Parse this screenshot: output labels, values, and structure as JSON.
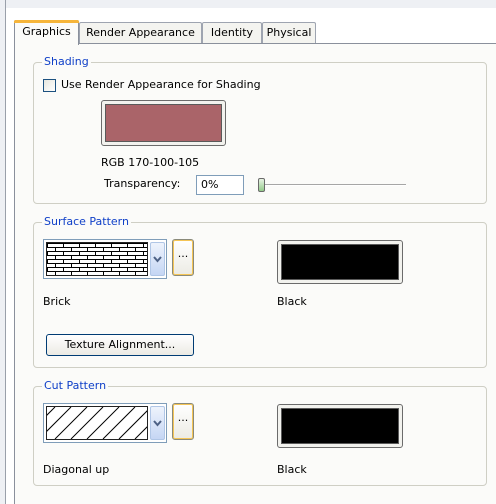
{
  "tabs": [
    {
      "label": "Graphics",
      "active": true
    },
    {
      "label": "Render Appearance",
      "active": false
    },
    {
      "label": "Identity",
      "active": false
    },
    {
      "label": "Physical",
      "active": false
    }
  ],
  "shading": {
    "legend": "Shading",
    "use_render_checkbox_label": "Use Render Appearance for Shading",
    "use_render_checked": false,
    "color_hex": "#aa6469",
    "rgb_label": "RGB 170-100-105",
    "transparency_label": "Transparency:",
    "transparency_value": "0%",
    "transparency_slider_percent": 0
  },
  "surface_pattern": {
    "legend": "Surface Pattern",
    "pattern_name": "Brick",
    "ellipsis_label": "...",
    "color_label": "Black",
    "color_hex": "#000000",
    "texture_button_label": "Texture Alignment..."
  },
  "cut_pattern": {
    "legend": "Cut Pattern",
    "pattern_name": "Diagonal up",
    "ellipsis_label": "...",
    "color_label": "Black",
    "color_hex": "#000000"
  },
  "colors": {
    "legend_text": "#1040c8",
    "tab_highlight": "#f6b53a"
  },
  "icons": {
    "combo_dropdown": "chevron-down-icon",
    "slider_thumb": "slider-thumb"
  }
}
